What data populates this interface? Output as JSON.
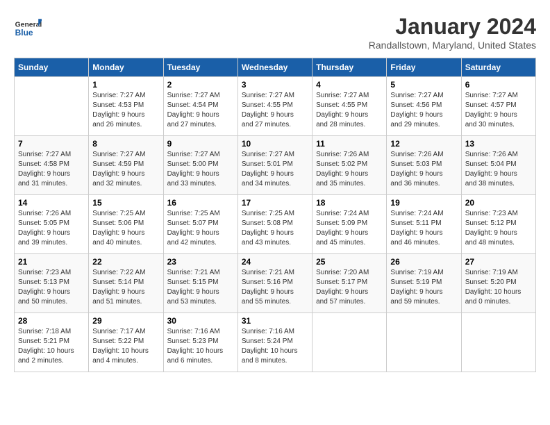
{
  "logo": {
    "text_general": "General",
    "text_blue": "Blue"
  },
  "title": "January 2024",
  "location": "Randallstown, Maryland, United States",
  "days_of_week": [
    "Sunday",
    "Monday",
    "Tuesday",
    "Wednesday",
    "Thursday",
    "Friday",
    "Saturday"
  ],
  "weeks": [
    [
      {
        "day": "",
        "info": ""
      },
      {
        "day": "1",
        "info": "Sunrise: 7:27 AM\nSunset: 4:53 PM\nDaylight: 9 hours\nand 26 minutes."
      },
      {
        "day": "2",
        "info": "Sunrise: 7:27 AM\nSunset: 4:54 PM\nDaylight: 9 hours\nand 27 minutes."
      },
      {
        "day": "3",
        "info": "Sunrise: 7:27 AM\nSunset: 4:55 PM\nDaylight: 9 hours\nand 27 minutes."
      },
      {
        "day": "4",
        "info": "Sunrise: 7:27 AM\nSunset: 4:55 PM\nDaylight: 9 hours\nand 28 minutes."
      },
      {
        "day": "5",
        "info": "Sunrise: 7:27 AM\nSunset: 4:56 PM\nDaylight: 9 hours\nand 29 minutes."
      },
      {
        "day": "6",
        "info": "Sunrise: 7:27 AM\nSunset: 4:57 PM\nDaylight: 9 hours\nand 30 minutes."
      }
    ],
    [
      {
        "day": "7",
        "info": "Sunrise: 7:27 AM\nSunset: 4:58 PM\nDaylight: 9 hours\nand 31 minutes."
      },
      {
        "day": "8",
        "info": "Sunrise: 7:27 AM\nSunset: 4:59 PM\nDaylight: 9 hours\nand 32 minutes."
      },
      {
        "day": "9",
        "info": "Sunrise: 7:27 AM\nSunset: 5:00 PM\nDaylight: 9 hours\nand 33 minutes."
      },
      {
        "day": "10",
        "info": "Sunrise: 7:27 AM\nSunset: 5:01 PM\nDaylight: 9 hours\nand 34 minutes."
      },
      {
        "day": "11",
        "info": "Sunrise: 7:26 AM\nSunset: 5:02 PM\nDaylight: 9 hours\nand 35 minutes."
      },
      {
        "day": "12",
        "info": "Sunrise: 7:26 AM\nSunset: 5:03 PM\nDaylight: 9 hours\nand 36 minutes."
      },
      {
        "day": "13",
        "info": "Sunrise: 7:26 AM\nSunset: 5:04 PM\nDaylight: 9 hours\nand 38 minutes."
      }
    ],
    [
      {
        "day": "14",
        "info": "Sunrise: 7:26 AM\nSunset: 5:05 PM\nDaylight: 9 hours\nand 39 minutes."
      },
      {
        "day": "15",
        "info": "Sunrise: 7:25 AM\nSunset: 5:06 PM\nDaylight: 9 hours\nand 40 minutes."
      },
      {
        "day": "16",
        "info": "Sunrise: 7:25 AM\nSunset: 5:07 PM\nDaylight: 9 hours\nand 42 minutes."
      },
      {
        "day": "17",
        "info": "Sunrise: 7:25 AM\nSunset: 5:08 PM\nDaylight: 9 hours\nand 43 minutes."
      },
      {
        "day": "18",
        "info": "Sunrise: 7:24 AM\nSunset: 5:09 PM\nDaylight: 9 hours\nand 45 minutes."
      },
      {
        "day": "19",
        "info": "Sunrise: 7:24 AM\nSunset: 5:11 PM\nDaylight: 9 hours\nand 46 minutes."
      },
      {
        "day": "20",
        "info": "Sunrise: 7:23 AM\nSunset: 5:12 PM\nDaylight: 9 hours\nand 48 minutes."
      }
    ],
    [
      {
        "day": "21",
        "info": "Sunrise: 7:23 AM\nSunset: 5:13 PM\nDaylight: 9 hours\nand 50 minutes."
      },
      {
        "day": "22",
        "info": "Sunrise: 7:22 AM\nSunset: 5:14 PM\nDaylight: 9 hours\nand 51 minutes."
      },
      {
        "day": "23",
        "info": "Sunrise: 7:21 AM\nSunset: 5:15 PM\nDaylight: 9 hours\nand 53 minutes."
      },
      {
        "day": "24",
        "info": "Sunrise: 7:21 AM\nSunset: 5:16 PM\nDaylight: 9 hours\nand 55 minutes."
      },
      {
        "day": "25",
        "info": "Sunrise: 7:20 AM\nSunset: 5:17 PM\nDaylight: 9 hours\nand 57 minutes."
      },
      {
        "day": "26",
        "info": "Sunrise: 7:19 AM\nSunset: 5:19 PM\nDaylight: 9 hours\nand 59 minutes."
      },
      {
        "day": "27",
        "info": "Sunrise: 7:19 AM\nSunset: 5:20 PM\nDaylight: 10 hours\nand 0 minutes."
      }
    ],
    [
      {
        "day": "28",
        "info": "Sunrise: 7:18 AM\nSunset: 5:21 PM\nDaylight: 10 hours\nand 2 minutes."
      },
      {
        "day": "29",
        "info": "Sunrise: 7:17 AM\nSunset: 5:22 PM\nDaylight: 10 hours\nand 4 minutes."
      },
      {
        "day": "30",
        "info": "Sunrise: 7:16 AM\nSunset: 5:23 PM\nDaylight: 10 hours\nand 6 minutes."
      },
      {
        "day": "31",
        "info": "Sunrise: 7:16 AM\nSunset: 5:24 PM\nDaylight: 10 hours\nand 8 minutes."
      },
      {
        "day": "",
        "info": ""
      },
      {
        "day": "",
        "info": ""
      },
      {
        "day": "",
        "info": ""
      }
    ]
  ]
}
